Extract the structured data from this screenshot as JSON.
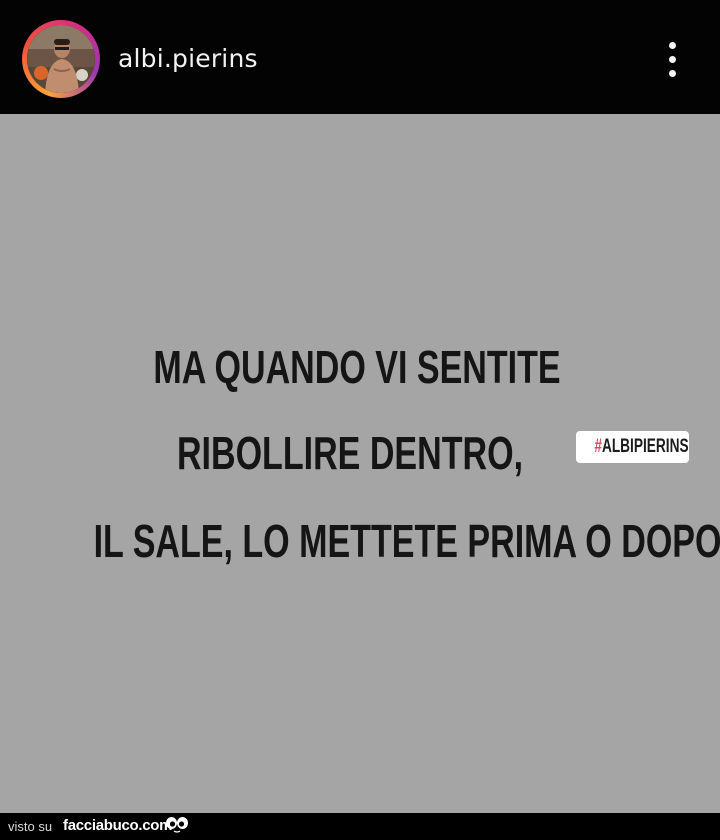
{
  "header": {
    "username": "albi.pierins"
  },
  "story": {
    "caption_lines": [
      "MA QUANDO VI SENTITE",
      "RIBOLLIRE DENTRO,",
      "IL SALE, LO METTETE PRIMA O DOPO?"
    ],
    "hashtag": {
      "symbol": "#",
      "text": "ALBIPIERINS"
    },
    "background_color": "#a5a5a5"
  },
  "footer": {
    "visto_label": "visto su",
    "site_name": "facciabuco.com"
  },
  "icons": {
    "more_menu": "more-vertical-icon",
    "avatar": "profile-avatar",
    "watermark_logo": "eyes-icon"
  },
  "colors": {
    "header_bg": "#030303",
    "avatar_ring": [
      "#f9a43a",
      "#f0533b",
      "#d92e7f",
      "#9b36b7"
    ],
    "hashtag_symbol": "#e0475e",
    "caption_text": "#151515"
  }
}
